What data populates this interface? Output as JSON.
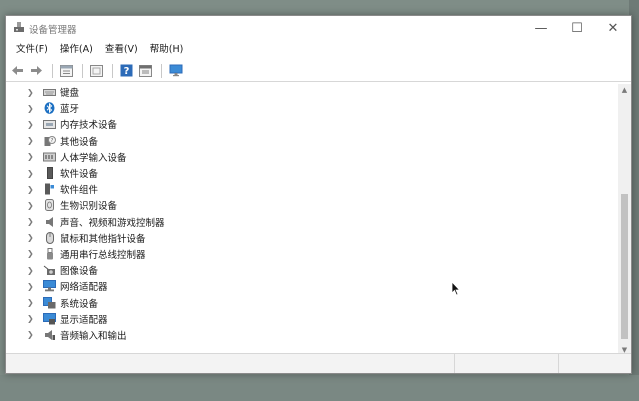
{
  "window": {
    "title": "设备管理器",
    "controls": {
      "minimize": "—",
      "maximize": "☐",
      "close": "✕"
    }
  },
  "menu": [
    "文件(F)",
    "操作(A)",
    "查看(V)",
    "帮助(H)"
  ],
  "toolbar": {
    "icons": [
      "back-arrow-icon",
      "forward-arrow-icon",
      "properties-icon",
      "scan-icon",
      "help-icon",
      "view-icon",
      "monitor-icon"
    ]
  },
  "devices": [
    {
      "label": "键盘",
      "icon": "keyboard-icon"
    },
    {
      "label": "蓝牙",
      "icon": "bluetooth-icon"
    },
    {
      "label": "内存技术设备",
      "icon": "memory-icon"
    },
    {
      "label": "其他设备",
      "icon": "unknown-device-icon"
    },
    {
      "label": "人体学输入设备",
      "icon": "hid-icon"
    },
    {
      "label": "软件设备",
      "icon": "software-device-icon"
    },
    {
      "label": "软件组件",
      "icon": "software-component-icon"
    },
    {
      "label": "生物识别设备",
      "icon": "biometric-icon"
    },
    {
      "label": "声音、视频和游戏控制器",
      "icon": "speaker-icon"
    },
    {
      "label": "鼠标和其他指针设备",
      "icon": "mouse-icon"
    },
    {
      "label": "通用串行总线控制器",
      "icon": "usb-icon"
    },
    {
      "label": "图像设备",
      "icon": "camera-icon"
    },
    {
      "label": "网络适配器",
      "icon": "network-icon"
    },
    {
      "label": "系统设备",
      "icon": "system-device-icon"
    },
    {
      "label": "显示适配器",
      "icon": "display-adapter-icon"
    },
    {
      "label": "音频输入和输出",
      "icon": "audio-io-icon"
    }
  ],
  "colors": {
    "accent": "#1b6fc2",
    "desktop": "#7f8d87"
  }
}
